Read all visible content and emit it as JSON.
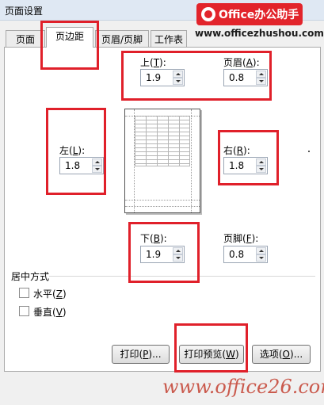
{
  "dialog": {
    "title": "页面设置"
  },
  "watermark": {
    "brand": "Office办公助手",
    "url": "www.officezhushou.com",
    "bottom": "www.office26.com"
  },
  "tabs": [
    {
      "label": "页面",
      "active": false
    },
    {
      "label": "页边距",
      "active": true
    },
    {
      "label": "页眉/页脚",
      "active": false
    },
    {
      "label": "工作表",
      "active": false
    }
  ],
  "margins": {
    "top": {
      "label": "上",
      "key": "T",
      "value": "1.9"
    },
    "header": {
      "label": "页眉",
      "key": "A",
      "value": "0.8"
    },
    "left": {
      "label": "左",
      "key": "L",
      "value": "1.8"
    },
    "right": {
      "label": "右",
      "key": "R",
      "value": "1.8"
    },
    "bottom": {
      "label": "下",
      "key": "B",
      "value": "1.9"
    },
    "footer": {
      "label": "页脚",
      "key": "F",
      "value": "0.8"
    }
  },
  "centering": {
    "title": "居中方式",
    "horizontal": {
      "label": "水平",
      "key": "Z",
      "checked": false
    },
    "vertical": {
      "label": "垂直",
      "key": "V",
      "checked": false
    }
  },
  "buttons": {
    "print": {
      "label": "打印",
      "key": "P",
      "suffix": "..."
    },
    "preview": {
      "label": "打印预览",
      "key": "W",
      "suffix": ""
    },
    "options": {
      "label": "选项",
      "key": "O",
      "suffix": "..."
    }
  },
  "colors": {
    "annotation": "#e0202a",
    "brand": "#e2242b"
  }
}
